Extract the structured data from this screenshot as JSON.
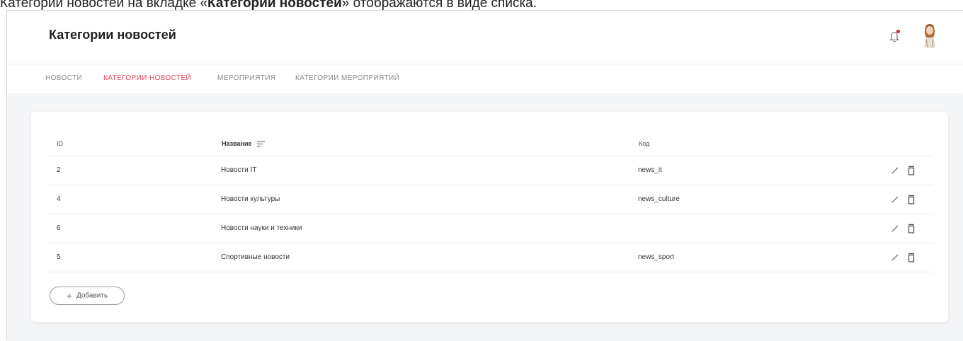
{
  "caption": {
    "prefix": "Категории новостей на вкладке «",
    "bold": "Категории новостей",
    "suffix": "» отображаются в виде списка."
  },
  "header": {
    "title": "Категории новостей",
    "bell_icon": "bell-icon",
    "notification_dot_color": "#e3263a"
  },
  "tabs": [
    {
      "label": "Новости",
      "active": false
    },
    {
      "label": "Категории новостей",
      "active": true
    },
    {
      "label": "Мероприятия",
      "active": false
    },
    {
      "label": "Категории мероприятий",
      "active": false
    }
  ],
  "accent_color": "#e44a5a",
  "table": {
    "columns": {
      "id": "ID",
      "name": "Название",
      "code": "Код"
    },
    "rows": [
      {
        "id": "2",
        "name": "Новости IT",
        "code": "news_it"
      },
      {
        "id": "4",
        "name": "Новости культуры",
        "code": "news_culture"
      },
      {
        "id": "6",
        "name": "Новости науки и техники",
        "code": ""
      },
      {
        "id": "5",
        "name": "Спортивные новости",
        "code": "news_sport"
      }
    ]
  },
  "add_button": {
    "label": "Добавить",
    "icon": "plus-icon"
  }
}
